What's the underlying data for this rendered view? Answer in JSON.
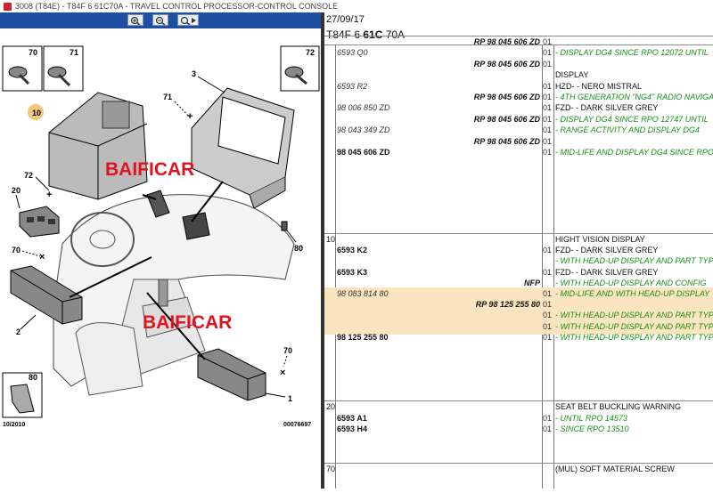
{
  "window": {
    "title": "3008 (T84E) - T84F 6 61C70A - TRAVEL CONTROL PROCESSOR-CONTROL CONSOLE"
  },
  "toolbar": {
    "buttons": [
      "zoom-in-icon",
      "zoom-out-icon",
      "zoom-search-icon"
    ]
  },
  "diagram": {
    "labels": {
      "p70a": "70",
      "p71a": "71",
      "p72a": "72",
      "p3": "3",
      "p71b": "71",
      "p10": "10",
      "p72b": "72",
      "p20": "20",
      "p80a": "80",
      "p70b": "70",
      "p2": "2",
      "p70c": "70",
      "p80b": "80",
      "p1": "1"
    },
    "watermark": "BAIFICAR",
    "date": "10/2010",
    "drawing_no": "00076697"
  },
  "header": {
    "date": "27/09/17",
    "code_prefix": "T84F 6 ",
    "code_bold": "61C",
    "code_suffix": " 70A"
  },
  "sections": [
    {
      "label": "",
      "rows": [
        {
          "ref": "",
          "rp": "RP 98 045 606 ZD",
          "qty": "01",
          "desc": ""
        },
        {
          "ref": "6593 Q0",
          "rp": "",
          "qty": "01",
          "desc": "- DISPLAY DG4 SINCE RPO 12072 UNTIL"
        },
        {
          "ref": "",
          "rp": "RP 98 045 606 ZD",
          "qty": "01",
          "desc": ""
        },
        {
          "ref": "",
          "rp": "",
          "qty": "",
          "desc": "DISPLAY",
          "k": true
        },
        {
          "ref": "6593 R2",
          "rp": "",
          "qty": "01",
          "desc": "HZD- - NERO MISTRAL",
          "k": true
        },
        {
          "ref": "",
          "rp": "RP 98 045 606 ZD",
          "qty": "01",
          "desc": "- 4TH GENERATION \"NG4\" RADIO NAVIGA"
        },
        {
          "ref": "98 006 850 ZD",
          "rp": "",
          "qty": "01",
          "desc": "FZD- - DARK SILVER GREY",
          "k": true
        },
        {
          "ref": "",
          "rp": "RP 98 045 606 ZD",
          "qty": "01",
          "desc": "- DISPLAY DG4 SINCE RPO 12747 UNTIL"
        },
        {
          "ref": "98 043 349 ZD",
          "rp": "",
          "qty": "01",
          "desc": "- RANGE ACTIVITY AND DISPLAY DG4"
        },
        {
          "ref": "",
          "rp": "RP 98 045 606 ZD",
          "qty": "01",
          "desc": ""
        },
        {
          "ref": "98 045 606 ZD",
          "rp": "",
          "qty": "01",
          "desc": "- MID-LIFE AND DISPLAY DG4 SINCE RPO",
          "b": true
        }
      ]
    },
    {
      "label": "10",
      "rows": [
        {
          "ref": "",
          "rp": "",
          "qty": "",
          "desc": "HIGHT VISION DISPLAY",
          "k": true
        },
        {
          "ref": "6593 K2",
          "rp": "",
          "qty": "01",
          "desc": "FZD- - DARK SILVER GREY",
          "k": true,
          "b": true
        },
        {
          "ref": "",
          "rp": "",
          "qty": "",
          "desc": "- WITH HEAD-UP DISPLAY AND PART TYP"
        },
        {
          "ref": "6593 K3",
          "rp": "",
          "qty": "01",
          "desc": "FZD- - DARK SILVER GREY",
          "k": true,
          "b": true
        },
        {
          "ref": "",
          "rp": "NFP",
          "qty": "",
          "desc": "- WITH HEAD-UP DISPLAY AND CONFIG"
        },
        {
          "ref": "98 083 814 80",
          "rp": "",
          "qty": "01",
          "desc": "- MID-LIFE AND WITH HEAD-UP DISPLAY"
        },
        {
          "ref": "",
          "rp": "RP 98 125 255 80",
          "qty": "01",
          "desc": ""
        },
        {
          "ref": "",
          "rp": "",
          "qty": "01",
          "desc": "- WITH HEAD-UP DISPLAY AND PART TYP"
        },
        {
          "ref": "",
          "rp": "",
          "qty": "01",
          "desc": "- WITH HEAD-UP DISPLAY AND PART TYP"
        },
        {
          "ref": "98 125 255 80",
          "rp": "",
          "qty": "01",
          "desc": "- WITH HEAD-UP DISPLAY AND PART TYP",
          "b": true
        }
      ]
    },
    {
      "label": "20",
      "rows": [
        {
          "ref": "",
          "rp": "",
          "qty": "",
          "desc": "SEAT BELT BUCKLING WARNING",
          "k": true
        },
        {
          "ref": "6593 A1",
          "rp": "",
          "qty": "01",
          "desc": "- UNTIL RPO 14573",
          "b": true
        },
        {
          "ref": "6593 H4",
          "rp": "",
          "qty": "01",
          "desc": "- SINCE RPO 13510",
          "b": true
        }
      ]
    },
    {
      "label": "70",
      "rows": [
        {
          "ref": "",
          "rp": "",
          "qty": "",
          "desc": "(MUL) SOFT MATERIAL SCREW",
          "k": true
        }
      ]
    }
  ]
}
